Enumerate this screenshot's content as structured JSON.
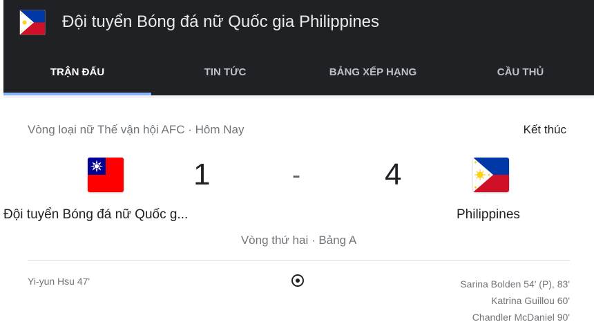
{
  "header": {
    "title": "Đội tuyển Bóng đá nữ Quốc gia Philippines",
    "flag_icon": "philippines-flag-icon",
    "background": "#202124",
    "accent": "#8ab4f8"
  },
  "tabs": [
    {
      "label": "TRẬN ĐẤU",
      "active": true
    },
    {
      "label": "TIN TỨC",
      "active": false
    },
    {
      "label": "BẢNG XẾP HẠNG",
      "active": false
    },
    {
      "label": "CẦU THỦ",
      "active": false
    }
  ],
  "match": {
    "competition": "Vòng loại nữ Thế vận hội AFC · Hôm Nay",
    "status": "Kết thúc",
    "home": {
      "name": "Đội tuyển Bóng đá nữ Quốc g...",
      "score": "1",
      "flag_icon": "taiwan-flag-icon"
    },
    "separator": "-",
    "away": {
      "name": "Philippines",
      "score": "4",
      "flag_icon": "philippines-flag-icon"
    },
    "round": "Vòng thứ hai · Bảng A",
    "goal_icon": "soccer-ball-icon",
    "home_scorers": [
      "Yi-yun Hsu 47'"
    ],
    "away_scorers": [
      "Sarina Bolden 54' (P), 83'",
      "Katrina Guillou 60'",
      "Chandler McDaniel 90'"
    ]
  }
}
